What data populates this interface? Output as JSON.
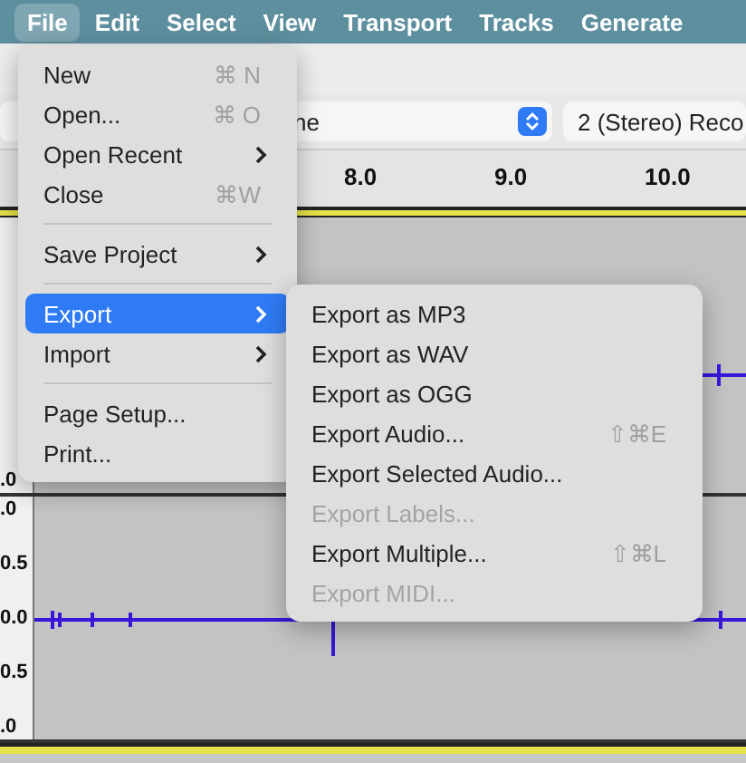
{
  "menubar": [
    {
      "label": "File",
      "selected": true
    },
    {
      "label": "Edit",
      "selected": false
    },
    {
      "label": "Select",
      "selected": false
    },
    {
      "label": "View",
      "selected": false
    },
    {
      "label": "Transport",
      "selected": false
    },
    {
      "label": "Tracks",
      "selected": false
    },
    {
      "label": "Generate",
      "selected": false
    }
  ],
  "device_row": {
    "input_device": "ne",
    "channels": "2 (Stereo) Reco"
  },
  "ruler": [
    "8.0",
    "9.0",
    "10.0"
  ],
  "tracks": [
    {
      "scale": [
        ".0"
      ]
    },
    {
      "scale": [
        ".0",
        "0.5",
        "0.0",
        "0.5",
        ".0"
      ]
    }
  ],
  "file_menu": [
    {
      "kind": "item",
      "label": "New",
      "shortcut": "⌘ N",
      "submenu": false,
      "selected": false
    },
    {
      "kind": "item",
      "label": "Open...",
      "shortcut": "⌘ O",
      "submenu": false,
      "selected": false
    },
    {
      "kind": "item",
      "label": "Open Recent",
      "submenu": true,
      "selected": false
    },
    {
      "kind": "item",
      "label": "Close",
      "shortcut": "⌘W",
      "submenu": false,
      "selected": false
    },
    {
      "kind": "separator"
    },
    {
      "kind": "item",
      "label": "Save Project",
      "submenu": true,
      "selected": false
    },
    {
      "kind": "separator"
    },
    {
      "kind": "item",
      "label": "Export",
      "submenu": true,
      "selected": true
    },
    {
      "kind": "item",
      "label": "Import",
      "submenu": true,
      "selected": false
    },
    {
      "kind": "separator"
    },
    {
      "kind": "item",
      "label": "Page Setup...",
      "submenu": false,
      "selected": false
    },
    {
      "kind": "item",
      "label": "Print...",
      "submenu": false,
      "selected": false
    }
  ],
  "export_submenu": [
    {
      "label": "Export as MP3",
      "disabled": false
    },
    {
      "label": "Export as WAV",
      "disabled": false
    },
    {
      "label": "Export as OGG",
      "disabled": false
    },
    {
      "label": "Export Audio...",
      "shortcut": "⇧⌘E",
      "disabled": false
    },
    {
      "label": "Export Selected Audio...",
      "disabled": false
    },
    {
      "label": "Export Labels...",
      "disabled": true
    },
    {
      "label": "Export Multiple...",
      "shortcut": "⇧⌘L",
      "disabled": false
    },
    {
      "label": "Export MIDI...",
      "disabled": true
    }
  ]
}
